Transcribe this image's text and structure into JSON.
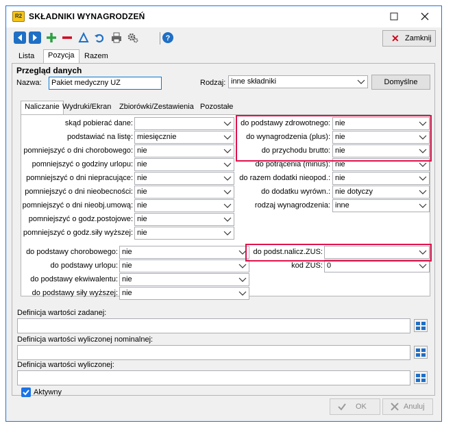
{
  "window": {
    "app_icon_text": "R2",
    "title": "SKŁADNIKI WYNAGRODZEŃ"
  },
  "toolbar": {
    "close_label": "Zamknij"
  },
  "main_tabs": [
    "Lista",
    "Pozycja",
    "Razem"
  ],
  "section": {
    "title": "Przegląd danych",
    "nazwa_label": "Nazwa:",
    "nazwa_value": "Pakiet medyczny UZ",
    "rodzaj_label": "Rodzaj:",
    "rodzaj_value": "inne składniki",
    "default_button": "Domyślne"
  },
  "sub_tabs": [
    "Naliczanie",
    "Wydruki/Ekran",
    "Zbiorówki/Zestawienia",
    "Pozostałe"
  ],
  "left_fields": [
    {
      "label": "skąd pobierać dane:",
      "value": ""
    },
    {
      "label": "podstawiać na listę:",
      "value": "miesięcznie"
    },
    {
      "label": "pomniejszyć o dni chorobowego:",
      "value": "nie"
    },
    {
      "label": "pomniejszyć o godziny urlopu:",
      "value": "nie"
    },
    {
      "label": "pomniejszyć o dni niepracujące:",
      "value": "nie"
    },
    {
      "label": "pomniejszyć o dni nieobecności:",
      "value": "nie"
    },
    {
      "label": "pomniejszyć o dni nieobj.umową:",
      "value": "nie"
    },
    {
      "label": "pomniejszyć o godz.postojowe:",
      "value": "nie"
    },
    {
      "label": "pomniejszyć o godz.siły wyższej:",
      "value": "nie"
    }
  ],
  "right_fields": [
    {
      "label": "do podstawy zdrowotnego:",
      "value": "nie"
    },
    {
      "label": "do wynagrodzenia (plus):",
      "value": "nie"
    },
    {
      "label": "do przychodu brutto:",
      "value": "nie"
    },
    {
      "label": "do potrącenia (minus):",
      "value": "nie"
    },
    {
      "label": "do razem dodatki nieopod.:",
      "value": "nie"
    },
    {
      "label": "do dodatku wyrówn.:",
      "value": "nie dotyczy"
    },
    {
      "label": "rodzaj wynagrodzenia:",
      "value": "inne"
    }
  ],
  "lower_left_fields": [
    {
      "label": "do podstawy chorobowego:",
      "value": "nie"
    },
    {
      "label": "do podstawy urlopu:",
      "value": "nie"
    },
    {
      "label": "do podstawy ekwiwalentu:",
      "value": "nie"
    },
    {
      "label": "do podstawy siły wyższej:",
      "value": "nie"
    }
  ],
  "lower_right_fields": [
    {
      "label": "do podst.nalicz.ZUS:",
      "value": ""
    },
    {
      "label": "kod ZUS:",
      "value": "0"
    }
  ],
  "definitions": [
    {
      "label": "Definicja wartości zadanej:",
      "value": ""
    },
    {
      "label": "Definicja wartości wyliczonej nominalnej:",
      "value": ""
    },
    {
      "label": "Definicja wartości wyliczonej:",
      "value": ""
    }
  ],
  "active_checkbox": {
    "label": "Aktywny",
    "checked": true
  },
  "footer": {
    "ok_label": "OK",
    "cancel_label": "Anuluj"
  },
  "colors": {
    "highlight": "#e0114b",
    "accent": "#1a73e8"
  }
}
